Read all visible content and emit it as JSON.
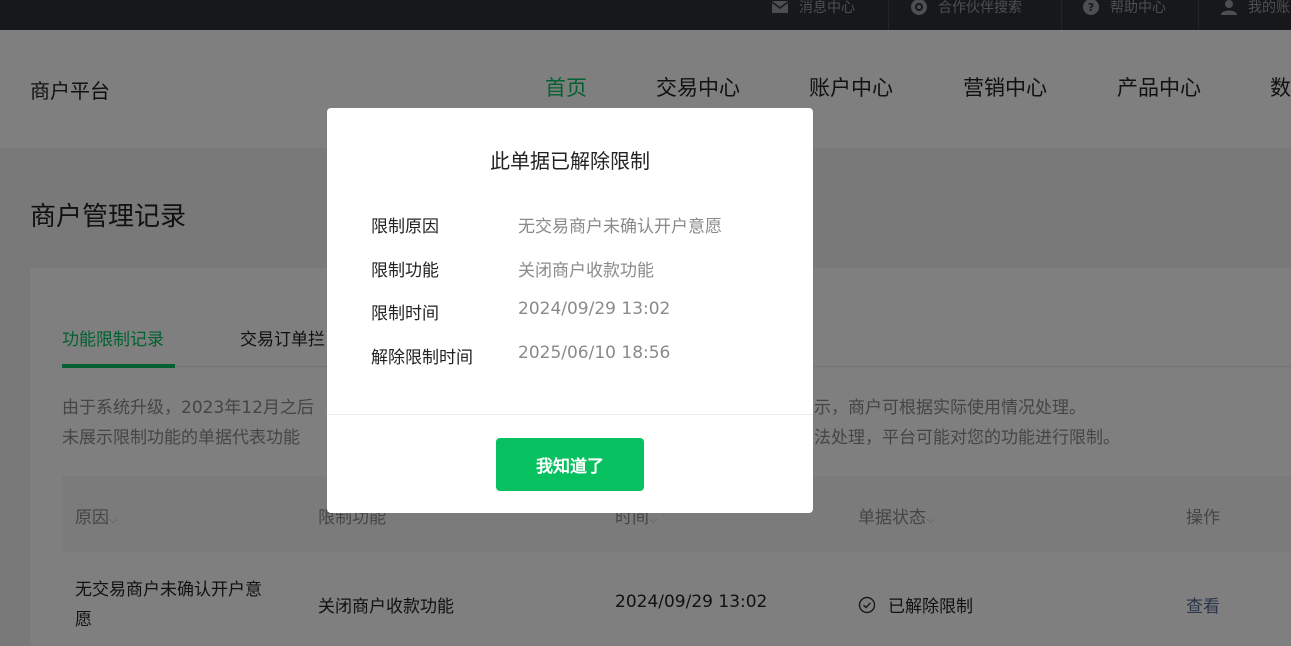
{
  "topbar": {
    "items": [
      {
        "label": "消息中心",
        "icon": "mail-icon"
      },
      {
        "label": "合作伙伴搜索",
        "icon": "at-sign-icon"
      },
      {
        "label": "帮助中心",
        "icon": "help-icon"
      },
      {
        "label": "我的账",
        "icon": "user-icon"
      }
    ]
  },
  "header": {
    "brand": "商户平台",
    "nav": [
      "首页",
      "交易中心",
      "账户中心",
      "营销中心",
      "产品中心",
      "数"
    ]
  },
  "page": {
    "title": "商户管理记录",
    "tabs": [
      "功能限制记录",
      "交易订单拦"
    ],
    "notice_line1_start": "由于系统升级，2023年12月之后",
    "notice_line1_end": "示，商户可根据实际使用情况处理。",
    "notice_line2_start": "未展示限制功能的单据代表功能",
    "notice_line2_end": "法处理，平台可能对您的功能进行限制。"
  },
  "table": {
    "headers": [
      "原因",
      "限制功能",
      "时间",
      "单据状态",
      "操作"
    ],
    "rows": [
      {
        "reason_line1": "无交易商户未确认开户意",
        "reason_line2": "愿",
        "function": "关闭商户收款功能",
        "time": "2024/09/29 13:02",
        "status": "已解除限制",
        "action": "查看"
      }
    ]
  },
  "dialog": {
    "title": "此单据已解除限制",
    "rows": [
      {
        "label": "限制原因",
        "value": "无交易商户未确认开户意愿"
      },
      {
        "label": "限制功能",
        "value": "关闭商户收款功能"
      },
      {
        "label": "限制时间",
        "value": "2024/09/29 13:02"
      },
      {
        "label": "解除限制时间",
        "value": "2025/06/10 18:56"
      }
    ],
    "button": "我知道了"
  },
  "colors": {
    "accent": "#07c160",
    "link": "#576b95",
    "topbar": "#2e3033"
  }
}
